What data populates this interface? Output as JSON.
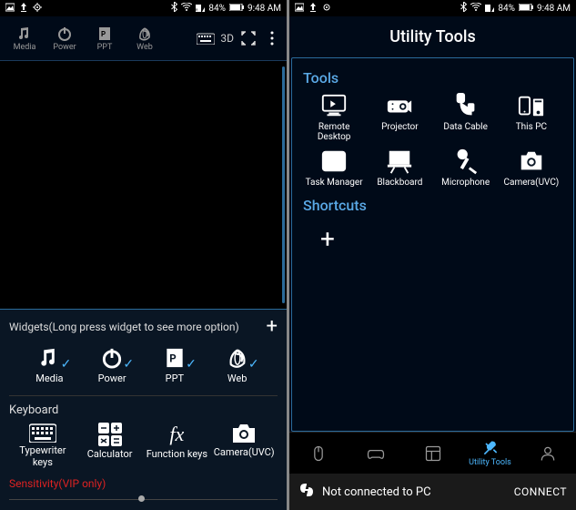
{
  "status": {
    "battery_pct": "84%",
    "time": "9:48 AM"
  },
  "left": {
    "topbar": {
      "media": "Media",
      "power": "Power",
      "ppt": "PPT",
      "web": "Web",
      "threeD": "3D"
    },
    "widgets": {
      "title": "Widgets(Long press widget to see more option)",
      "media": "Media",
      "power": "Power",
      "ppt": "PPT",
      "web": "Web"
    },
    "keyboard": {
      "title": "Keyboard",
      "typewriter": "Typewriter keys",
      "calculator": "Calculator",
      "function": "Function keys",
      "camera": "Camera(UVC)"
    },
    "sensitivity": "Sensitivity(VIP only)"
  },
  "right": {
    "title": "Utility Tools",
    "tools_head": "Tools",
    "tools": {
      "remote": "Remote Desktop",
      "projector": "Projector",
      "cable": "Data Cable",
      "thispc": "This PC",
      "task": "Task Manager",
      "blackboard": "Blackboard",
      "mic": "Microphone",
      "camera": "Camera(UVC)"
    },
    "shortcuts_head": "Shortcuts",
    "nav": {
      "utility": "Utility Tools"
    },
    "connect": {
      "status": "Not connected to PC",
      "button": "CONNECT"
    }
  }
}
